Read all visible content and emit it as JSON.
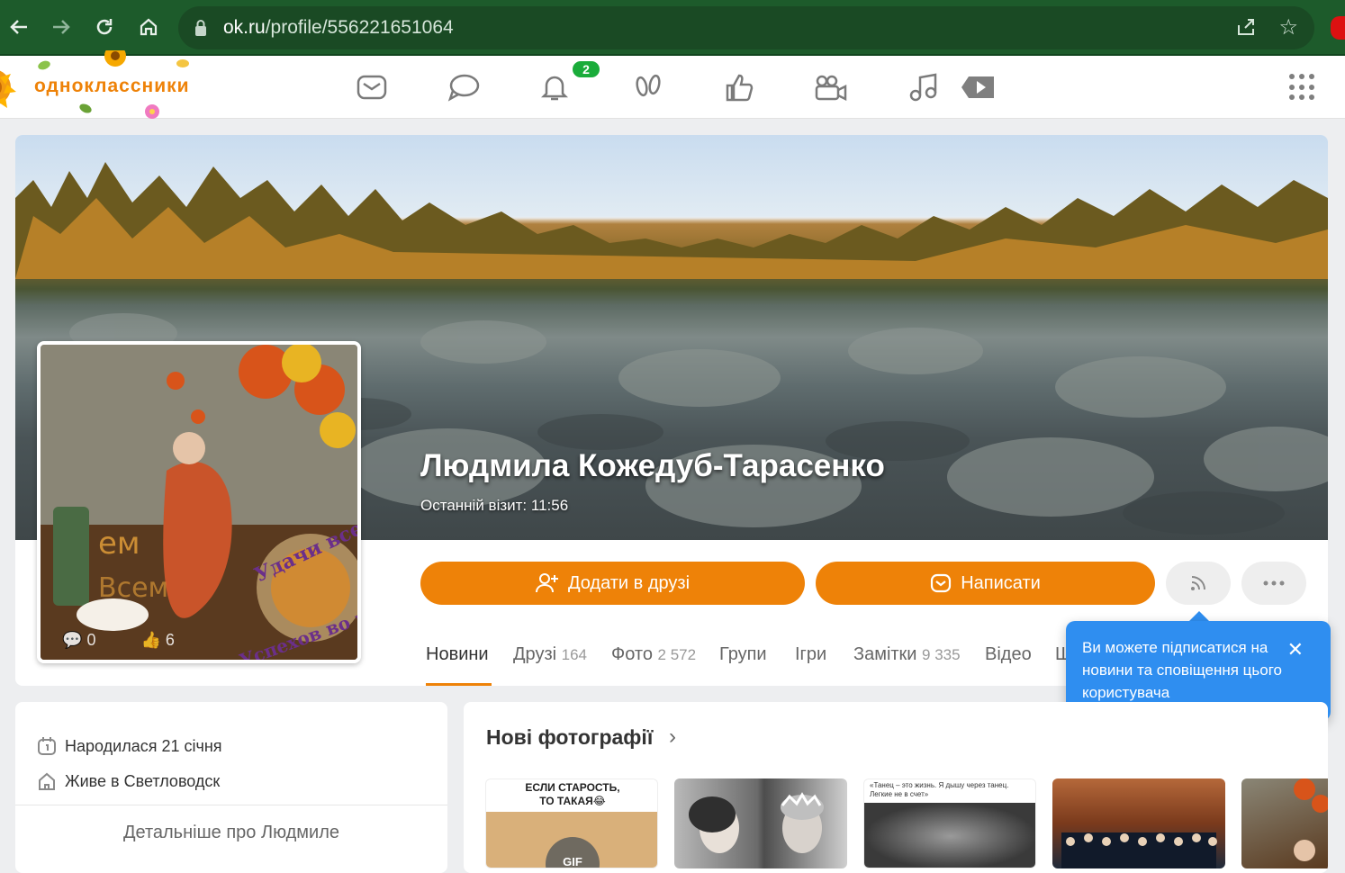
{
  "browser": {
    "url_prefix": "ok.ru",
    "url_path": "/profile/556221651064",
    "back_icon": "back-arrow-icon",
    "forward_icon": "forward-arrow-icon",
    "reload_icon": "reload-icon",
    "home_icon": "home-icon",
    "colors": {
      "chrome_bg": "#1d5b2b",
      "url_bg": "#1a4a24"
    }
  },
  "header": {
    "logo_text": "одноклассники",
    "notifications_badge": "2",
    "nav_icons": [
      "mail-icon",
      "discussions-icon",
      "notifications-icon",
      "guests-icon",
      "likes-icon",
      "video-icon",
      "music-icon",
      "play-icon",
      "apps-grid-icon"
    ],
    "brand_color": "#ee8208"
  },
  "profile": {
    "name": "Людмила Кожедуб-Тарасенко",
    "last_visit": "Останній візит: 11:56",
    "avatar_comments": "0",
    "avatar_likes": "6",
    "add_friend_label": "Додати в друзі",
    "write_label": "Написати",
    "subscribe_icon": "rss-icon",
    "more_icon": "more-dots-icon"
  },
  "tabs": [
    {
      "label": "Новини",
      "count": ""
    },
    {
      "label": "Друзі",
      "count": "164"
    },
    {
      "label": "Фото",
      "count": "2 572"
    },
    {
      "label": "Групи",
      "count": ""
    },
    {
      "label": "Ігри",
      "count": ""
    },
    {
      "label": "Замітки",
      "count": "9 335"
    },
    {
      "label": "Відео",
      "count": ""
    },
    {
      "label": "Ш",
      "count": ""
    }
  ],
  "tooltip": {
    "text": "Ви можете підписатися на новини та сповіщення цього користувача",
    "color": "#2f8ef0"
  },
  "info": {
    "birthday": "Народилася 21 січня",
    "lives": "Живе в Светловодск",
    "more_link": "Детальніше про Людмиле"
  },
  "photos": {
    "title": "Нові фотографії",
    "thumb1_caption": "ЕСЛИ СТАРОСТЬ, ТО ТАКАЯ😂",
    "thumb1_badge": "GIF",
    "thumb3_caption": "«Танец – это жизнь. Я дышу через танец. Легкие не в счет»"
  }
}
